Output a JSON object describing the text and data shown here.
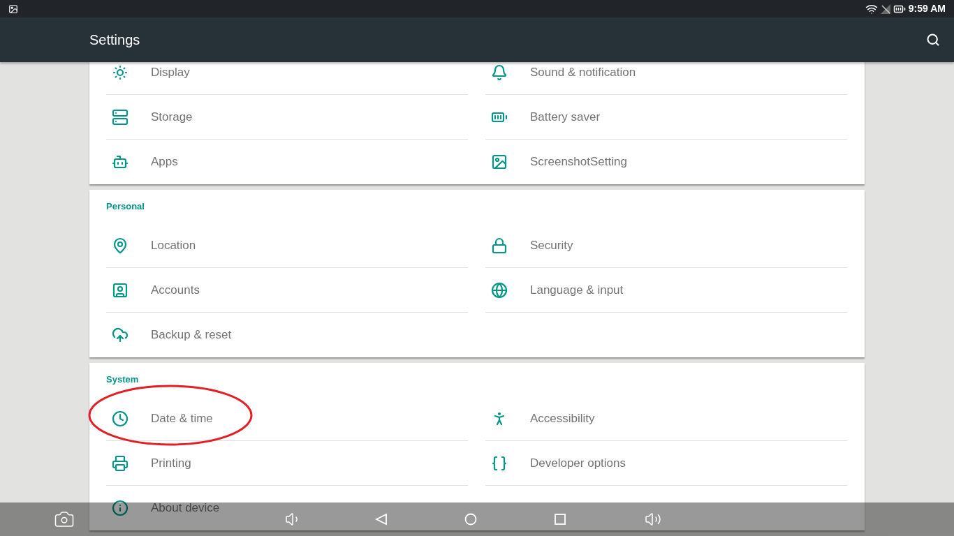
{
  "status_bar": {
    "time": "9:59 AM"
  },
  "app_bar": {
    "title": "Settings"
  },
  "sections": [
    {
      "items": [
        {
          "label": "Display"
        },
        {
          "label": "Sound & notification"
        },
        {
          "label": "Storage"
        },
        {
          "label": "Battery saver"
        },
        {
          "label": "Apps"
        },
        {
          "label": "ScreenshotSetting"
        }
      ]
    },
    {
      "header": "Personal",
      "items": [
        {
          "label": "Location"
        },
        {
          "label": "Security"
        },
        {
          "label": "Accounts"
        },
        {
          "label": "Language & input"
        },
        {
          "label": "Backup & reset"
        }
      ]
    },
    {
      "header": "System",
      "items": [
        {
          "label": "Date & time"
        },
        {
          "label": "Accessibility"
        },
        {
          "label": "Printing"
        },
        {
          "label": "Developer options"
        },
        {
          "label": "About device"
        }
      ]
    }
  ]
}
